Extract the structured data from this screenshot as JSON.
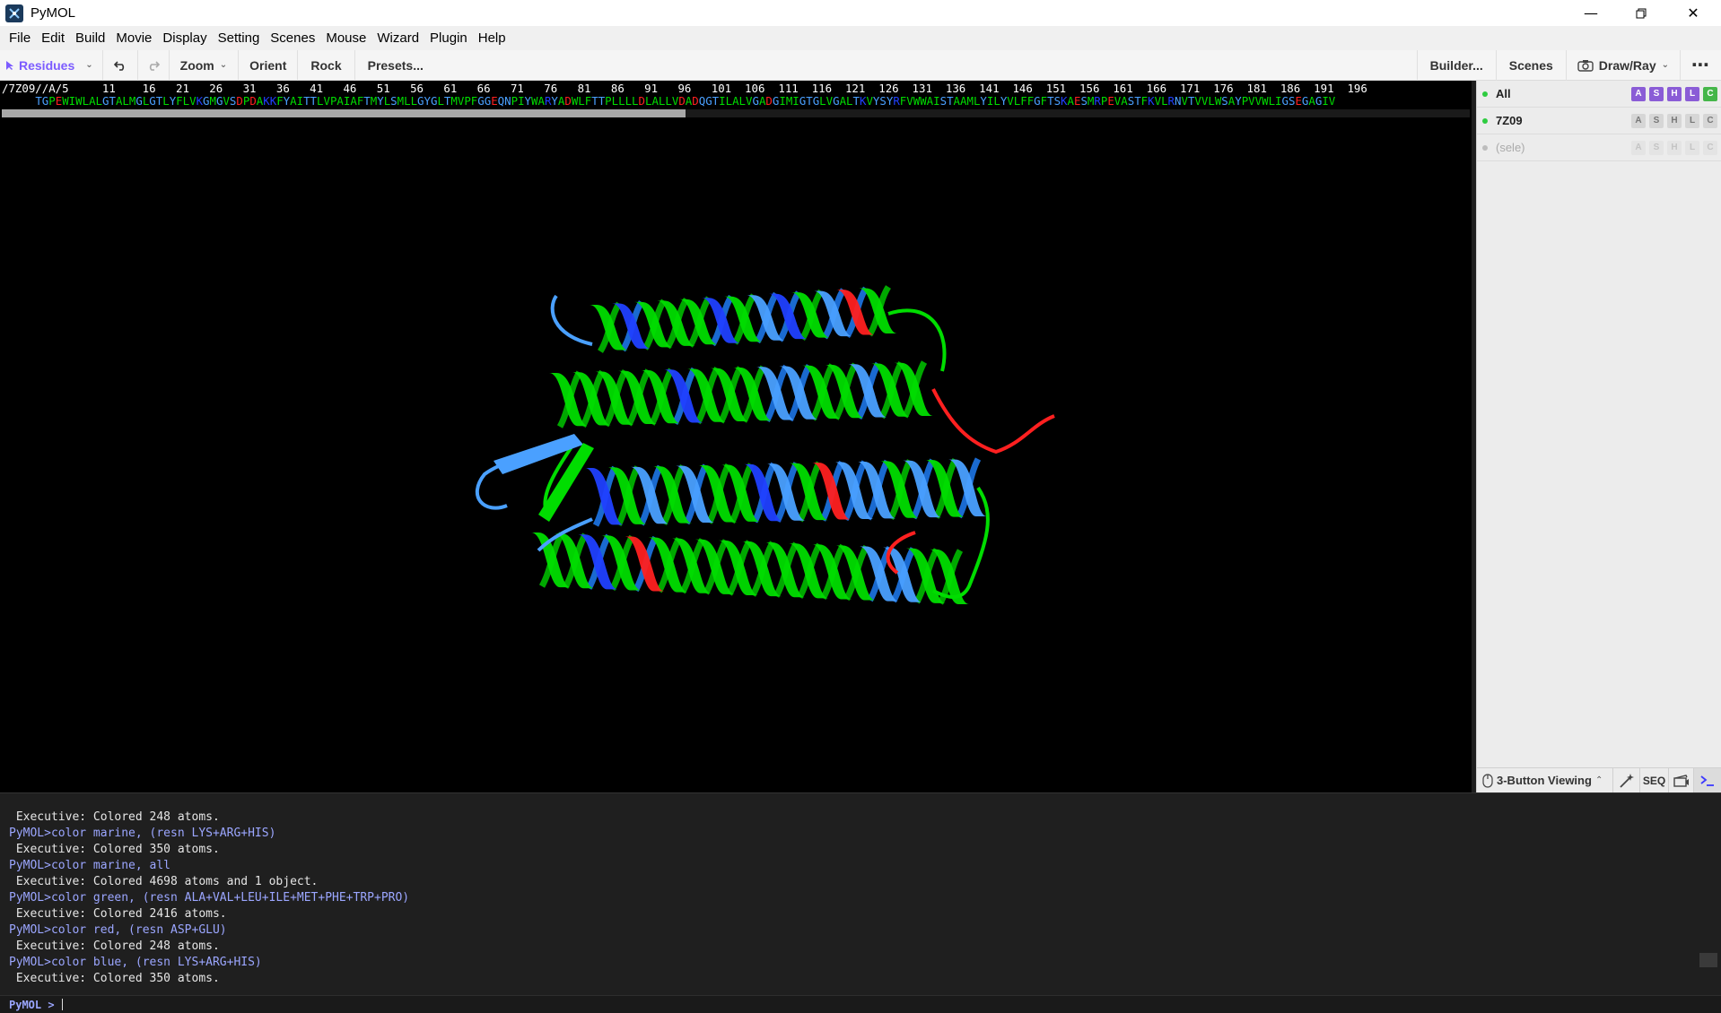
{
  "window": {
    "title": "PyMOL"
  },
  "menu": [
    "File",
    "Edit",
    "Build",
    "Movie",
    "Display",
    "Setting",
    "Scenes",
    "Mouse",
    "Wizard",
    "Plugin",
    "Help"
  ],
  "toolbar": {
    "mode_label": "Residues",
    "zoom_label": "Zoom",
    "orient_label": "Orient",
    "rock_label": "Rock",
    "presets_label": "Presets...",
    "builder_label": "Builder...",
    "scenes_label": "Scenes",
    "drawray_label": "Draw/Ray"
  },
  "sequence": {
    "header": "/7Z09//A/5",
    "numbers": "11    16   21   26   31   36   41   46   51   56   61   66   71   76   81   86   91   96   101  106  111  116  121  126  131  136  141  146  151  156  161  166  171  176  181  186  191  196",
    "letters": "TGPEWIWLALGTALMGLGTLYFLVKGMGVSDPDAKKFYAITTLVPAIAFTMYLSMLLGYGLTMVPFGGEQNPIYWARYADWLFTTPLLLLDLALLVDADQGTILALVGADGIMIGTGLVGALTKVYSYRFVWWAISTAAMLYILYVLFFGFTSKAESMRPEVASTFKVLRNVTVVLWSAYPVVWLIGSEGAGIV"
  },
  "objects": [
    {
      "name": "All",
      "buttons": [
        "A",
        "S",
        "H",
        "L",
        "C"
      ]
    },
    {
      "name": "7Z09",
      "buttons": [
        "A",
        "S",
        "H",
        "L",
        "C"
      ]
    },
    {
      "name": "(sele)",
      "buttons": [
        "A",
        "S",
        "H",
        "L",
        "C"
      ]
    }
  ],
  "panel_footer": {
    "mouse_mode": "3-Button Viewing",
    "seq_label": "SEQ"
  },
  "console": {
    "lines": [
      {
        "type": "out",
        "text": " Executive: Colored 248 atoms."
      },
      {
        "type": "cmd",
        "text": "PyMOL>color marine, (resn LYS+ARG+HIS)"
      },
      {
        "type": "out",
        "text": " Executive: Colored 350 atoms."
      },
      {
        "type": "cmd",
        "text": "PyMOL>color marine, all"
      },
      {
        "type": "out",
        "text": " Executive: Colored 4698 atoms and 1 object."
      },
      {
        "type": "cmd",
        "text": "PyMOL>color green, (resn ALA+VAL+LEU+ILE+MET+PHE+TRP+PRO)"
      },
      {
        "type": "out",
        "text": " Executive: Colored 2416 atoms."
      },
      {
        "type": "cmd",
        "text": "PyMOL>color red, (resn ASP+GLU)"
      },
      {
        "type": "out",
        "text": " Executive: Colored 248 atoms."
      },
      {
        "type": "cmd",
        "text": "PyMOL>color blue, (resn LYS+ARG+HIS)"
      },
      {
        "type": "out",
        "text": " Executive: Colored 350 atoms."
      }
    ],
    "prompt": "PyMOL >"
  },
  "colors": {
    "hydrophobic": "#00dd00",
    "acidic": "#ff2020",
    "basic": "#2040ff",
    "other": "#4aa0ff",
    "accent": "#7c5cff"
  }
}
